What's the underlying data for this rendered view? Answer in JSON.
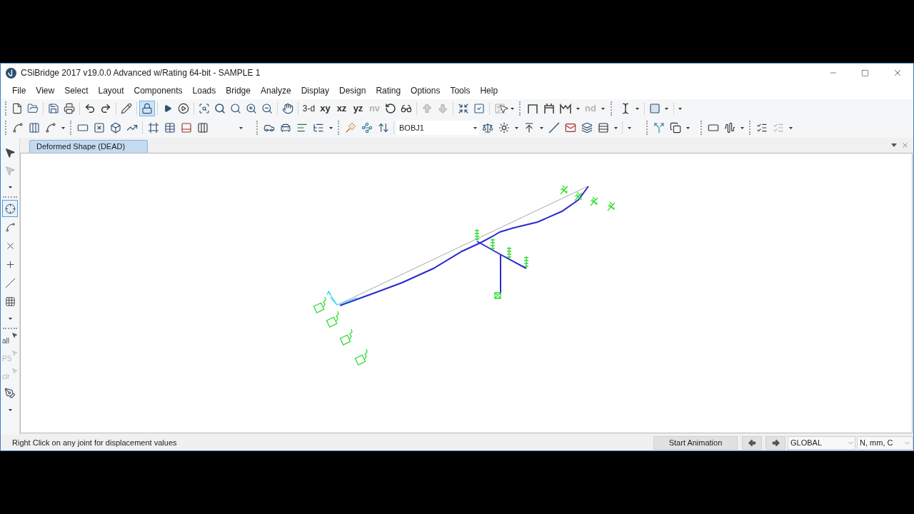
{
  "window": {
    "title": "CSiBridge 2017 v19.0.0 Advanced w/Rating 64-bit - SAMPLE 1"
  },
  "menu": [
    "File",
    "View",
    "Select",
    "Layout",
    "Components",
    "Loads",
    "Bridge",
    "Analyze",
    "Display",
    "Design",
    "Rating",
    "Options",
    "Tools",
    "Help"
  ],
  "toolbar": {
    "row_1": {
      "lock_button": {
        "on": true
      },
      "view_buttons": [
        {
          "label": "3-d",
          "disabled": false
        },
        {
          "label": "xy",
          "disabled": false
        },
        {
          "label": "xz",
          "disabled": false
        },
        {
          "label": "yz",
          "disabled": false
        },
        {
          "label": "nv",
          "disabled": true
        }
      ],
      "move_buttons": [
        {
          "kind": "up",
          "disabled": true
        },
        {
          "kind": "down",
          "disabled": true
        }
      ],
      "display_button": {
        "disabled": true
      },
      "text_button": {
        "label": "nd",
        "disabled": true
      }
    },
    "row_2": {
      "object_combo": {
        "value": "BOBJ1"
      },
      "check_tools": [
        {
          "disabled": false
        },
        {
          "disabled": true
        }
      ]
    }
  },
  "left_toolbar": {
    "pointer_tools": [
      {
        "disabled": false
      },
      {
        "disabled": true
      }
    ],
    "snap_tools": [
      {
        "kind": "joint",
        "selected": true
      },
      {
        "kind": "line",
        "selected": false
      },
      {
        "kind": "intersection",
        "selected": false
      },
      {
        "kind": "perpendicular",
        "selected": false
      },
      {
        "kind": "diagonal",
        "selected": false
      },
      {
        "kind": "grid",
        "selected": false
      }
    ],
    "select_buttons": [
      {
        "label": "all",
        "disabled": false
      },
      {
        "label": "PS",
        "disabled": true
      },
      {
        "label": "clr",
        "disabled": true
      }
    ]
  },
  "tabs": [
    {
      "label": "Deformed Shape (DEAD)",
      "selected": true
    }
  ],
  "status_bar": {
    "message": "Right Click on any joint for displacement values",
    "animation_button": "Start Animation",
    "coordinate_system": "GLOBAL",
    "units": "N, mm, C"
  }
}
